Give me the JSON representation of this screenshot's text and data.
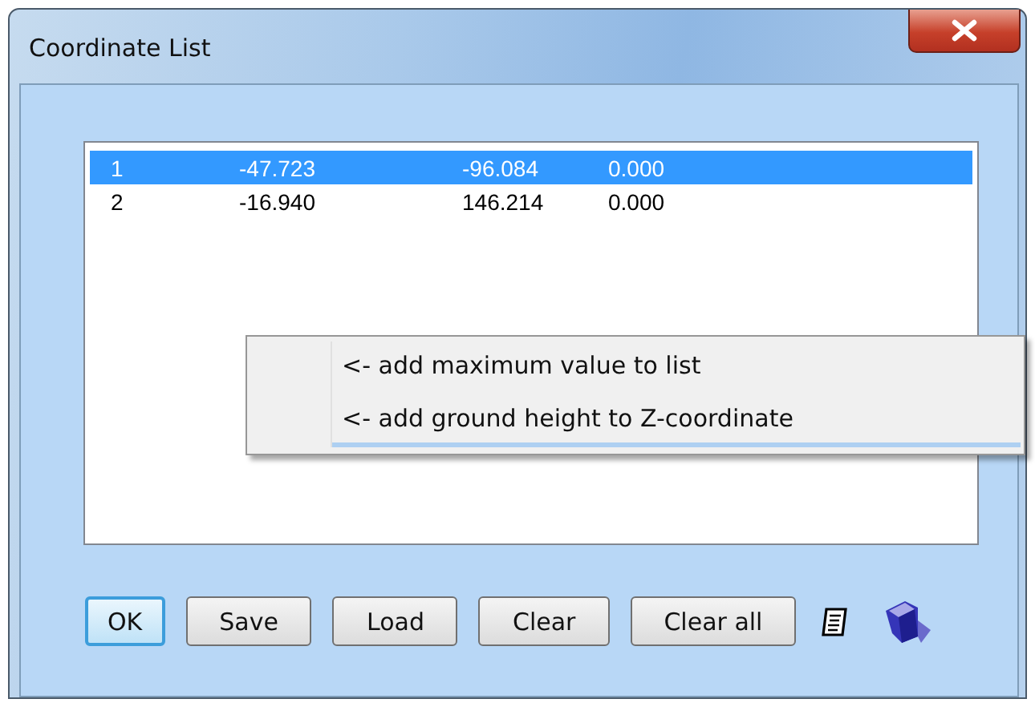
{
  "window": {
    "title": "Coordinate List"
  },
  "rows": [
    {
      "cells": [
        "1",
        "-47.723",
        "-96.084",
        "0.000"
      ],
      "selected": true
    },
    {
      "cells": [
        "2",
        "-16.940",
        "146.214",
        "0.000"
      ],
      "selected": false
    }
  ],
  "context_menu": {
    "items": [
      {
        "label": "<- add maximum value to list",
        "selected": false
      },
      {
        "label": "<- add ground height to Z-coordinate",
        "selected": true
      }
    ]
  },
  "buttons": [
    {
      "label": "OK",
      "focused": true
    },
    {
      "label": "Save",
      "focused": false
    },
    {
      "label": "Load",
      "focused": false
    },
    {
      "label": "Clear",
      "focused": false
    },
    {
      "label": "Clear all",
      "focused": false
    }
  ]
}
